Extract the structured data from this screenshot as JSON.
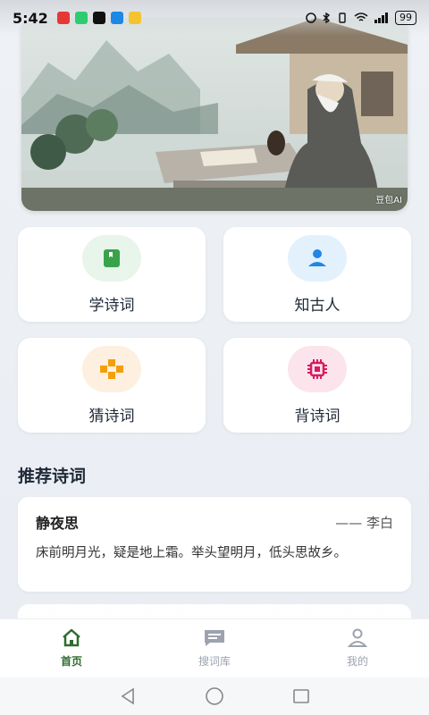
{
  "status_bar": {
    "time": "5:42",
    "battery": "99"
  },
  "hero": {
    "watermark": "豆包AI"
  },
  "features": [
    {
      "label": "学诗词",
      "icon": "book-icon",
      "icon_color": "#3aa34a",
      "bg": "#e8f5ea"
    },
    {
      "label": "知古人",
      "icon": "person-icon",
      "icon_color": "#1e88e5",
      "bg": "#e3f1fd"
    },
    {
      "label": "猜诗词",
      "icon": "gamepad-icon",
      "icon_color": "#f59e0b",
      "bg": "#fdf0e0"
    },
    {
      "label": "背诗词",
      "icon": "chip-icon",
      "icon_color": "#d81b60",
      "bg": "#fce4ec"
    }
  ],
  "section": {
    "title": "推荐诗词"
  },
  "poem": {
    "title": "静夜思",
    "author": "—— 李白",
    "content": "床前明月光，疑是地上霜。举头望明月，低头思故乡。"
  },
  "bottom_nav": [
    {
      "label": "首页",
      "icon": "home-icon",
      "active": true
    },
    {
      "label": "搜词库",
      "icon": "chat-icon",
      "active": false
    },
    {
      "label": "我的",
      "icon": "user-icon",
      "active": false
    }
  ],
  "colors": {
    "accent": "#2f6b2f",
    "inactive": "#9ca3af"
  }
}
